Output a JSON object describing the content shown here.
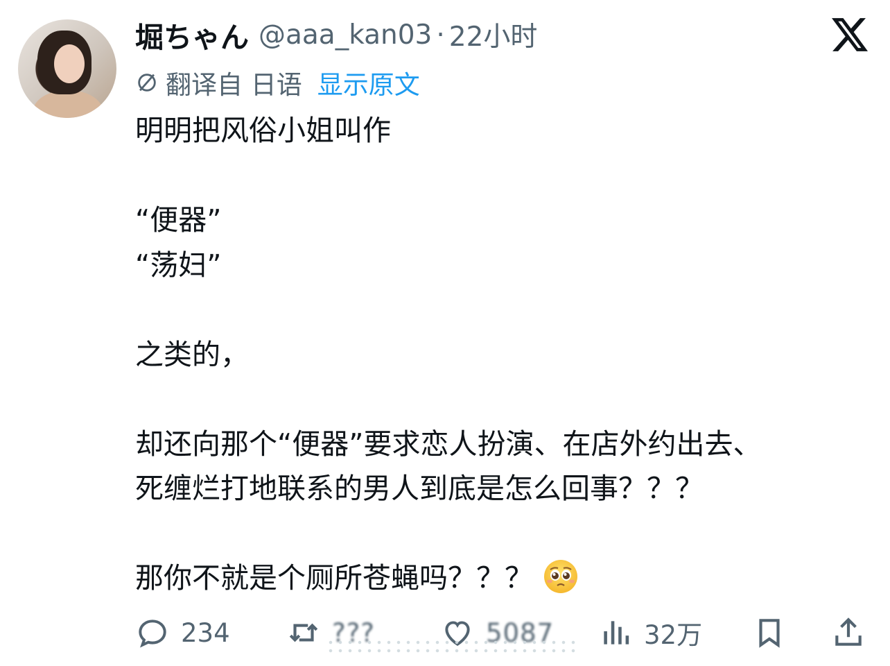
{
  "author": {
    "display_name": "堀ちゃん",
    "handle": "@aaa_kan03",
    "separator": "·",
    "time": "22小时"
  },
  "translation": {
    "label": "翻译自 日语",
    "show_original": "显示原文"
  },
  "post_lines": [
    "明明把风俗小姐叫作",
    "",
    "“便器”",
    "“荡妇”",
    "",
    "之类的，",
    "",
    "却还向那个“便器”要求恋人扮演、在店外约出去、",
    "死缠烂打地联系的男人到底是怎么回事？？？",
    "",
    "那你不就是个厕所苍蝇吗？？？"
  ],
  "emoji": "pleading-face",
  "stats": {
    "replies": "234",
    "reposts": "???",
    "likes": "5087",
    "views": "32万"
  },
  "colors": {
    "text": "#0f1419",
    "secondary": "#536471",
    "link": "#1d9bf0"
  }
}
